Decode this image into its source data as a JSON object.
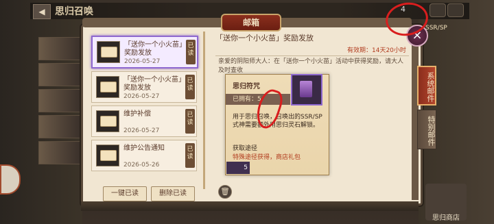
{
  "topbar": {
    "title": "思归召唤",
    "count": "4"
  },
  "window": {
    "title": "邮箱",
    "close_label": "×"
  },
  "mails": [
    {
      "title": "「送你一个小火苗」奖励发放",
      "date": "2026-05-27",
      "tag": "已读"
    },
    {
      "title": "「送你一个小火苗」奖励发放",
      "date": "2026-05-27",
      "tag": "已读"
    },
    {
      "title": "维护补偿",
      "date": "2026-05-27",
      "tag": "已读"
    },
    {
      "title": "维护公告通知",
      "date": "2026-05-26",
      "tag": "已读"
    }
  ],
  "buttons": {
    "read_all": "一键已读",
    "delete_read": "删除已读"
  },
  "detail": {
    "title": "「送你一个小火苗」奖励发放",
    "validity": "有效期：14天20小时",
    "body": "亲爱的阴阳师大人：在「送你一个小火苗」活动中获得奖励，请大人及时查收"
  },
  "tooltip": {
    "name": "思归符咒",
    "owned": "已拥有：5",
    "desc": "用于思归召唤，召唤出的SSR/SP式神需要额外用思归灵石解锁。",
    "how_label": "获取途径",
    "source": "特殊途径获得，商店礼包"
  },
  "reward_count": "5",
  "side_tabs": {
    "system": "系统邮件",
    "special": "特别邮件"
  },
  "side_info": {
    "ssr": "SSR/SP",
    "shop": "思归商店"
  }
}
